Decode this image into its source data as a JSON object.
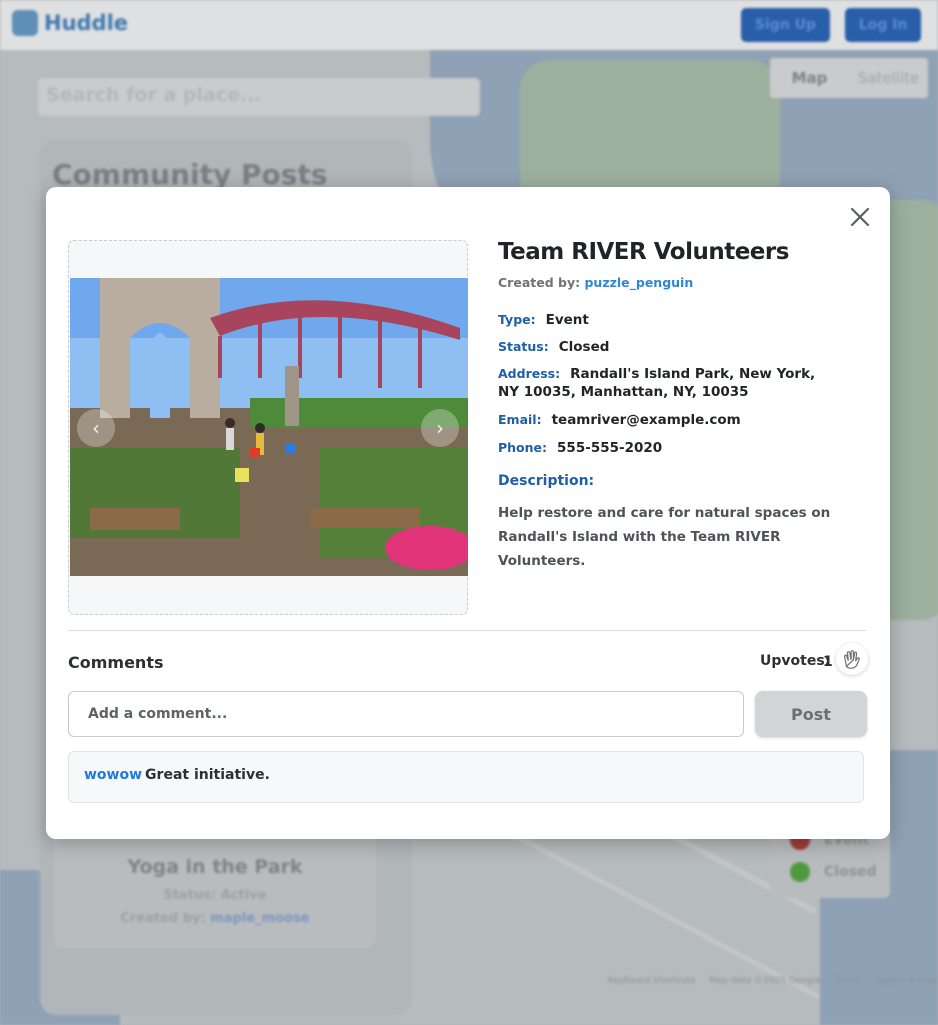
{
  "app": {
    "logo_text": "Huddle",
    "signup_label": "Sign Up",
    "login_label": "Log In"
  },
  "map": {
    "search_placeholder": "Search for a place...",
    "toggle": [
      "Map",
      "Satellite"
    ],
    "footer": [
      "Keyboard shortcuts",
      "Map data ©2025 Google",
      "Terms",
      "Report a map error"
    ]
  },
  "posts_panel": {
    "title": "Community Posts",
    "card": {
      "title": "Yoga in the Park",
      "status": "Status: Active",
      "created_by_label": "Created by:",
      "creator": "maple_moose"
    }
  },
  "legend": {
    "items": [
      {
        "label": "Event",
        "color": "#a33b3b"
      },
      {
        "label": "Closed",
        "color": "#4f9a3f"
      }
    ]
  },
  "modal": {
    "title": "Team RIVER Volunteers",
    "created_by_label": "Created by:",
    "creator": "puzzle_penguin",
    "type_label": "Type:",
    "type": "Event",
    "status_label": "Status:",
    "status": "Closed",
    "address_label": "Address:",
    "address": "Randall's Island Park, New York, NY 10035, Manhattan, NY, 10035",
    "email_label": "Email:",
    "email": "teamriver@example.com",
    "phone_label": "Phone:",
    "phone": "555-555-2020",
    "description_label": "Description:",
    "description": "Help restore and care for natural spaces on Randall's Island with the Team RIVER Volunteers.",
    "prev_arrow": "‹",
    "next_arrow": "›"
  },
  "comments": {
    "title": "Comments",
    "upvotes_label": "Upvotes:",
    "upvotes_count": "1",
    "input_placeholder": "Add a comment...",
    "post_label": "Post",
    "items": [
      {
        "author": "wowow",
        "text": "Great initiative."
      }
    ]
  },
  "colors": {
    "accent_blue": "#1e5fa8",
    "link_blue": "#2f86d6",
    "author_blue": "#1f7ae0"
  }
}
